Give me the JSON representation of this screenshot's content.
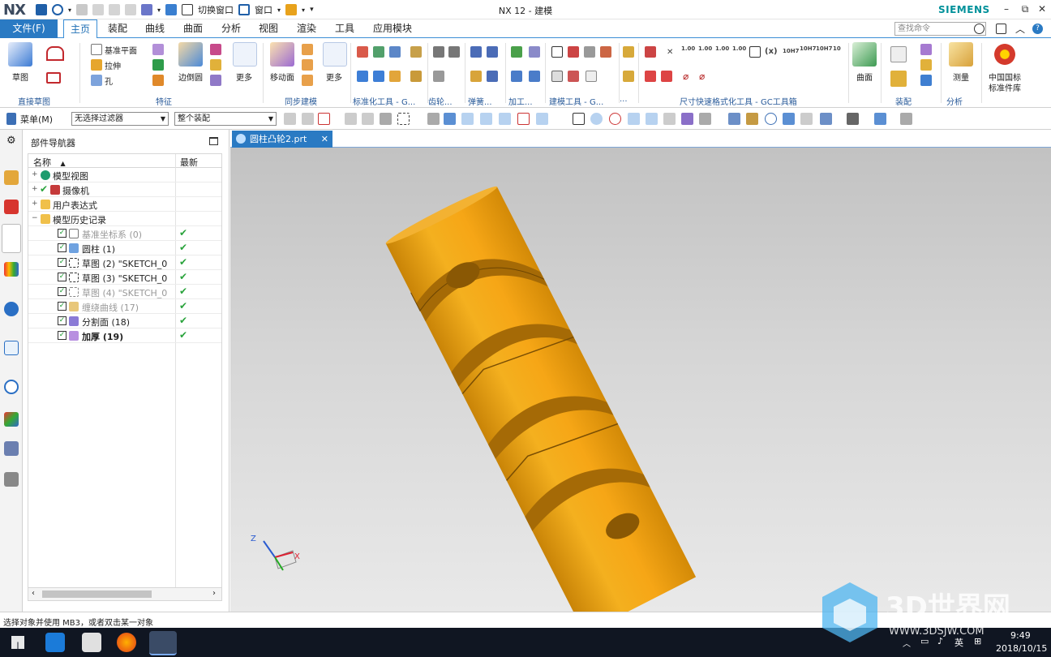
{
  "titlebar": {
    "logo": "NX",
    "title": "NX 12 - 建模",
    "brand": "SIEMENS",
    "qat_switch_window": "切换窗口",
    "qat_window": "窗口"
  },
  "tabs": {
    "file": "文件(F)",
    "items": [
      "主页",
      "装配",
      "曲线",
      "曲面",
      "分析",
      "视图",
      "渲染",
      "工具",
      "应用模块"
    ],
    "active": "主页",
    "search_placeholder": "查找命令"
  },
  "ribbon": {
    "sketch": "草图",
    "direct_sketch_group": "直接草图",
    "datum_plane": "基准平面",
    "extrude": "拉伸",
    "hole": "孔",
    "edge_blend": "边倒圆",
    "more": "更多",
    "feature_group": "特征",
    "move_face": "移动面",
    "more2": "更多",
    "sync_modeling_group": "同步建模",
    "standard_tools_group": "标准化工具 - G...",
    "gear_group": "齿轮...",
    "spring_group": "弹簧...",
    "machining_group": "加工...",
    "modeling_tools_group": "建模工具 - G...",
    "dim_group_short": "...",
    "dim_quick_group": "尺寸快速格式化工具 - GC工具箱",
    "surface": "曲面",
    "assembly_group": "装配",
    "measure": "测量",
    "analysis_group": "分析",
    "china_std": "中国国标",
    "china_std2": "标准件库",
    "fit_labels": [
      "1.00",
      "1.00",
      "1.00",
      "1.00",
      "10H7",
      "10H7",
      "10H7",
      "10"
    ]
  },
  "cmdbar": {
    "menu": "菜单(M)",
    "filter": "无选择过滤器",
    "scope": "整个装配"
  },
  "navigator": {
    "title": "部件导航器",
    "col_name": "名称",
    "col_latest": "最新",
    "rows": [
      {
        "label": "模型视图",
        "level": 0,
        "style": "normal"
      },
      {
        "label": "摄像机",
        "level": 0,
        "style": "normal"
      },
      {
        "label": "用户表达式",
        "level": 0,
        "style": "normal"
      },
      {
        "label": "模型历史记录",
        "level": 0,
        "style": "normal"
      },
      {
        "label": "基准坐标系 (0)",
        "level": 1,
        "style": "dim",
        "latest": "✔"
      },
      {
        "label": "圆柱 (1)",
        "level": 1,
        "style": "normal",
        "latest": "✔"
      },
      {
        "label": "草图 (2) \"SKETCH_0",
        "level": 1,
        "style": "normal",
        "latest": "✔"
      },
      {
        "label": "草图 (3) \"SKETCH_0",
        "level": 1,
        "style": "normal",
        "latest": "✔"
      },
      {
        "label": "草图 (4) \"SKETCH_0",
        "level": 1,
        "style": "dim",
        "latest": "✔"
      },
      {
        "label": "缠绕曲线 (17)",
        "level": 1,
        "style": "dim",
        "latest": "✔"
      },
      {
        "label": "分割面 (18)",
        "level": 1,
        "style": "normal",
        "latest": "✔"
      },
      {
        "label": "加厚 (19)",
        "level": 1,
        "style": "bold",
        "latest": "✔"
      }
    ]
  },
  "document": {
    "tab_label": "圆柱凸轮2.prt"
  },
  "viewport": {
    "triad_z": "Z",
    "triad_x": "X",
    "model_color": "#f0a41a"
  },
  "status": {
    "message": "选择对象并使用 MB3，或者双击某一对象"
  },
  "taskbar": {
    "ime": "英",
    "time": "9:49",
    "date": "2018/10/15"
  },
  "watermark": {
    "text": "3D世界网",
    "url": "WWW.3DSJW.COM"
  },
  "colors": {
    "accent": "#2a7ac3",
    "check": "#2aa33c",
    "model": "#f0a41a"
  }
}
